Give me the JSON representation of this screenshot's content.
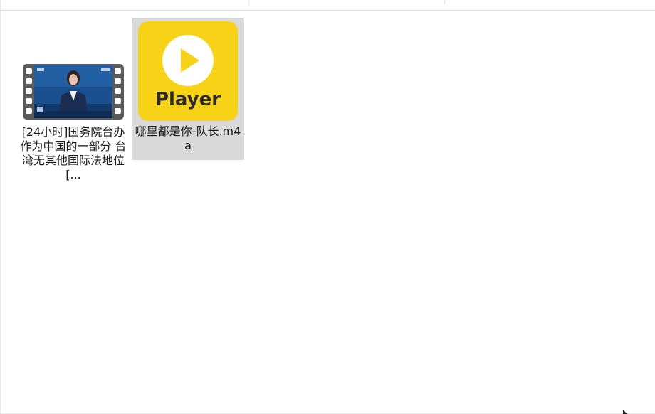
{
  "explorer": {
    "view": "large-icons",
    "files": [
      {
        "name": "[24小时]国务院台办 作为中国的一部分 台湾无其他国际法地位[...",
        "icon": "video-thumbnail-icon",
        "selected": false
      },
      {
        "name": "哪里都是你-队长.m4a",
        "icon": "player-app-icon",
        "icon_text": "Player",
        "selected": true
      }
    ]
  },
  "colors": {
    "selection": "#d9d9d9",
    "player_yellow": "#f7d216",
    "filmstrip": "#5a5a5a",
    "news_blue": "#1a4f8f"
  }
}
